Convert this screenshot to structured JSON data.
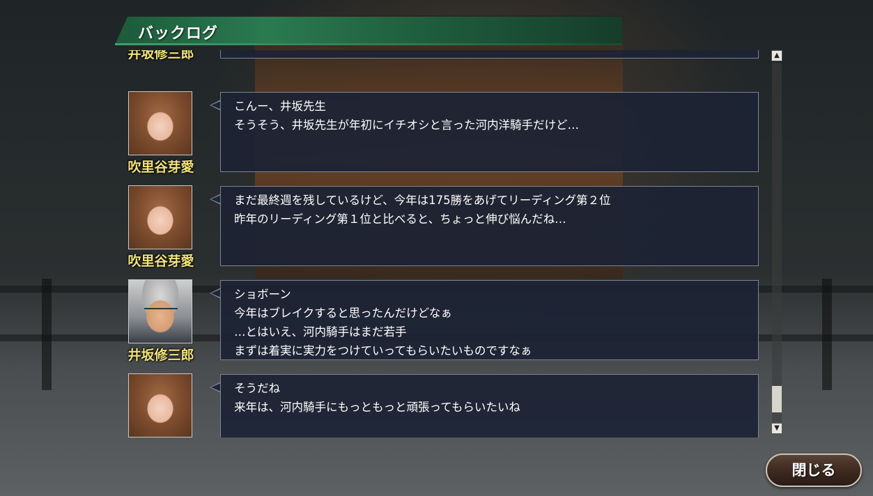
{
  "header": {
    "title": "バックログ"
  },
  "entries": [
    {
      "speaker": "井坂修三郎",
      "portrait": "man-portrait",
      "lines": []
    },
    {
      "speaker": "吹里谷芽愛",
      "portrait": "girl-portrait",
      "lines": [
        "こんー、井坂先生",
        "そうそう、井坂先生が年初にイチオシと言った河内洋騎手だけど…"
      ]
    },
    {
      "speaker": "吹里谷芽愛",
      "portrait": "girl-portrait",
      "lines": [
        "まだ最終週を残しているけど、今年は175勝をあげてリーディング第２位",
        "昨年のリーディング第１位と比べると、ちょっと伸び悩んだね…"
      ]
    },
    {
      "speaker": "井坂修三郎",
      "portrait": "man-portrait",
      "lines": [
        "ショボーン",
        "今年はブレイクすると思ったんだけどなぁ",
        "…とはいえ、河内騎手はまだ若手",
        "まずは着実に実力をつけていってもらいたいものですなぁ"
      ]
    },
    {
      "speaker": "",
      "portrait": "girl-portrait",
      "lines": [
        "そうだね",
        "来年は、河内騎手にもっともっと頑張ってもらいたいね"
      ]
    }
  ],
  "scrollbar": {
    "up_icon": "▲",
    "down_icon": "▼",
    "position": 0.95
  },
  "close_button": {
    "label": "閉じる"
  }
}
